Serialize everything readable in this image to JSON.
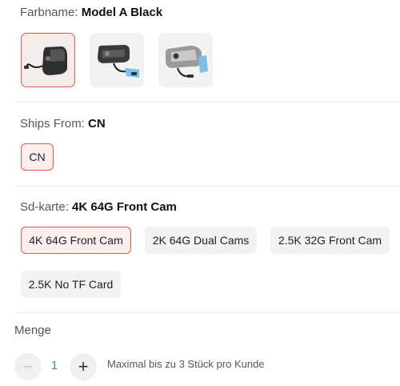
{
  "color": {
    "label": "Farbname:",
    "value": "Model A Black",
    "options": [
      {
        "icon": "dashcam-black-image",
        "selected": true
      },
      {
        "icon": "dashcam-grey-image",
        "selected": false
      },
      {
        "icon": "dashcam-silver-image",
        "selected": false
      }
    ]
  },
  "ships": {
    "label": "Ships From:",
    "value": "CN",
    "options": [
      {
        "label": "CN",
        "selected": true
      }
    ]
  },
  "sd": {
    "label": "Sd-karte:",
    "value": "4K 64G Front Cam",
    "options": [
      {
        "label": "4K 64G Front Cam",
        "selected": true
      },
      {
        "label": "2K 64G Dual Cams",
        "selected": false
      },
      {
        "label": "2.5K 32G Front Cam",
        "selected": false
      },
      {
        "label": "2.5K No TF Card",
        "selected": false
      }
    ]
  },
  "quantity": {
    "label": "Menge",
    "value": "1",
    "minus": "−",
    "plus": "+",
    "note": "Maximal bis zu 3 Stück pro Kunde"
  },
  "colors": {
    "accent": "#e0584a",
    "qty_value": "#3c8fb8",
    "chip_bg": "#f2f2f2"
  }
}
